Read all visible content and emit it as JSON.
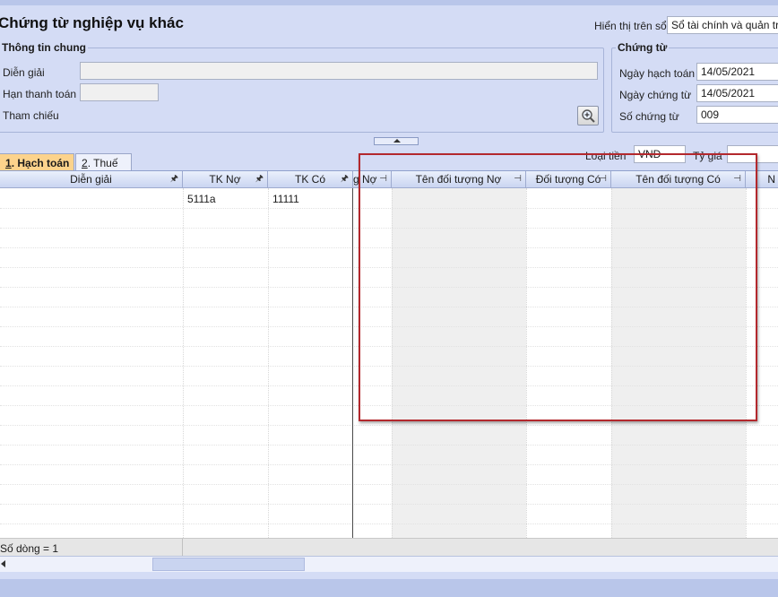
{
  "form": {
    "title": "Chứng từ nghiệp vụ khác",
    "display_on_label": "Hiển thị trên sổ",
    "display_on_value": "Sổ tài chính và quản trị"
  },
  "general_info": {
    "group_title": "Thông tin chung",
    "description_label": "Diễn giải",
    "description_value": "",
    "due_date_label": "Hạn thanh toán",
    "due_date_value": "",
    "reference_label": "Tham chiếu"
  },
  "voucher": {
    "group_title": "Chứng từ",
    "posting_date_label": "Ngày hạch toán",
    "posting_date_value": "14/05/2021",
    "voucher_date_label": "Ngày chứng từ",
    "voucher_date_value": "14/05/2021",
    "voucher_no_label": "Số chứng từ",
    "voucher_no_value": "009"
  },
  "tabs": [
    {
      "num": "1",
      "label": ". Hạch toán"
    },
    {
      "num": "2",
      "label": ". Thuế"
    }
  ],
  "currency": {
    "currency_label": "Loại tiền",
    "currency_value": "VND",
    "rate_label": "Tỷ giá",
    "rate_value": ""
  },
  "grid": {
    "columns": [
      "Diễn giải",
      "TK Nợ",
      "TK Có",
      "g Nợ",
      "Tên đối tượng Nợ",
      "Đối tượng Có",
      "Tên đối tượng Có",
      "N"
    ],
    "rows": [
      {
        "description": "",
        "debit_account": "5111a",
        "credit_account": "11111"
      }
    ],
    "row_count_text": "Số dòng = 1"
  },
  "icons": [
    "zoom-icon",
    "pin-icon",
    "collapse-arrow-icon",
    "scroll-left-icon"
  ],
  "colors": {
    "highlight_box": "#b3282d",
    "active_tab": "#fcd38c",
    "background": "#d4dcf5"
  }
}
